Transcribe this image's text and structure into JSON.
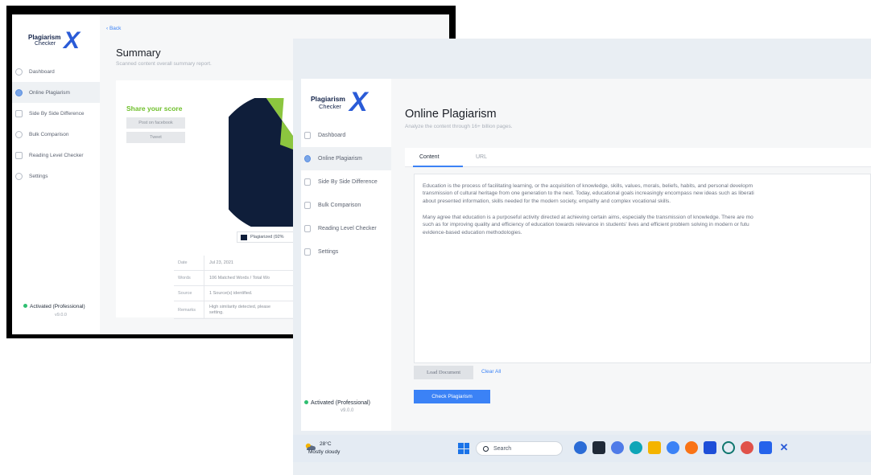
{
  "back_window": {
    "logo": {
      "line1": "Plagiarism",
      "line2": "Checker",
      "mark": "X"
    },
    "nav": [
      {
        "label": "Dashboard",
        "icon": "home-icon"
      },
      {
        "label": "Online Plagiarism",
        "icon": "globe-icon",
        "active": true
      },
      {
        "label": "Side By Side Difference",
        "icon": "compare-icon"
      },
      {
        "label": "Bulk Comparison",
        "icon": "cloud-icon"
      },
      {
        "label": "Reading Level Checker",
        "icon": "book-icon"
      },
      {
        "label": "Settings",
        "icon": "gear-icon"
      }
    ],
    "status": "Activated (Professional)",
    "version": "v9.0.0",
    "back_link": "‹ Back",
    "title": "Summary",
    "subtitle": "Scanned content overall summary report.",
    "share_title": "Share your score",
    "share_buttons": [
      "Post on facebook",
      "Tweet"
    ],
    "legend": "Plagiarized (92%",
    "details": [
      {
        "k": "Date",
        "v": "Jul 23, 2021"
      },
      {
        "k": "Words",
        "v": "106 Matched Words / Total Wo"
      },
      {
        "k": "Source",
        "v": "1 Source(s) identified."
      },
      {
        "k": "Remarks",
        "v": "High similarity detected, please"
      }
    ],
    "details_overflow": "setting.",
    "colors": {
      "pie_main": "#0f1e3a",
      "pie_slice": "#8cc63f",
      "share": "#6fbf2b"
    }
  },
  "front_window": {
    "logo": {
      "line1": "Plagiarism",
      "line2": "Checker",
      "mark": "X"
    },
    "nav": [
      {
        "label": "Dashboard",
        "icon": "home-icon"
      },
      {
        "label": "Online Plagiarism",
        "icon": "globe-icon",
        "active": true
      },
      {
        "label": "Side By Side Difference",
        "icon": "compare-icon"
      },
      {
        "label": "Bulk Comparison",
        "icon": "cloud-icon"
      },
      {
        "label": "Reading Level Checker",
        "icon": "book-icon"
      },
      {
        "label": "Settings",
        "icon": "gear-icon"
      }
    ],
    "status": "Activated (Professional)",
    "version": "v9.0.0",
    "title": "Online Plagiarism",
    "subtitle": "Analyze the content through 16+ billion pages.",
    "tabs": [
      "Content",
      "URL"
    ],
    "paragraph1": "Education is the process of facilitating learning, or the acquisition of knowledge, skills, values, morals, beliefs, habits, and personal developm\ntransmission of cultural heritage from one generation to the next. Today, educational goals increasingly encompass new ideas such as liberati\nabout presented information, skills needed for the modern society, empathy and complex vocational skills.",
    "paragraph2": "Many agree that education is a purposeful activity directed at achieving certain aims, especially the transmission of knowledge. There are mo\nsuch as for improving quality and efficiency of education towards relevance in students' lives and efficient problem solving in modern or futu\nevidence-based education methodologies.",
    "load_button": "Load Document",
    "clear_button": "Clear All",
    "check_button": "Check Plagiarism",
    "colors": {
      "accent": "#3b82f6"
    }
  },
  "taskbar": {
    "temperature": "28°C",
    "condition": "Mostly cloudy",
    "search_placeholder": "Search",
    "apps": [
      "widgets-icon",
      "file-explorer-icon",
      "copilot-icon",
      "edge-icon",
      "files-icon",
      "chrome-icon",
      "firefox-icon",
      "store-icon",
      "circle-app-icon",
      "chrome-alt-icon",
      "apps-icon",
      "plagiarism-checker-icon"
    ]
  }
}
